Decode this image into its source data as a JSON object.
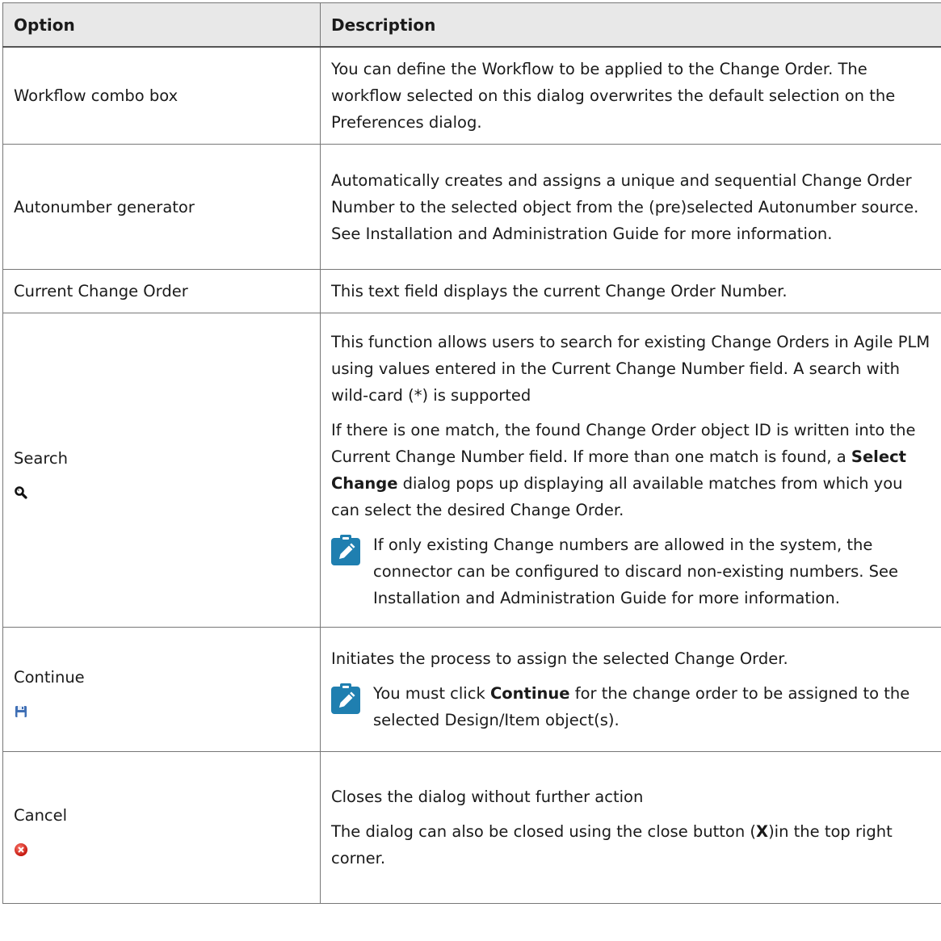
{
  "table": {
    "headers": {
      "option": "Option",
      "description": "Description"
    },
    "rows": [
      {
        "option": "Workflow combo box",
        "description": "You can define the Workflow to be applied to the Change Order. The workflow selected on this dialog overwrites the default selection on the Preferences dialog."
      },
      {
        "option": "Autonumber generator",
        "description": "Automatically creates and assigns a unique and sequential Change Order Number to the selected object from the (pre)selected Autonumber source. See Installation and Administration Guide for more information."
      },
      {
        "option": "Current Change Order",
        "description": "This text field displays the current Change Order Number."
      },
      {
        "option": "Search",
        "icon": "magnifier-icon",
        "description_p1": "This function allows users to search for existing Change Orders in Agile PLM using values entered in the Current Change Number field. A search with wild-card (*) is supported",
        "description_p2_a": "If there is one match, the found Change Order object ID is written into the Current Change Number field. If more than one match is found, a ",
        "description_p2_bold": "Select Change",
        "description_p2_b": " dialog pops up displaying all available matches from which you can select the desired Change Order.",
        "note": "If only existing Change numbers are allowed in the system, the connector can be configured to discard non-existing numbers. See Installation and Administration Guide for more information."
      },
      {
        "option": "Continue",
        "icon": "floppy-disk-icon",
        "description_p1": "Initiates the process to assign the selected Change Order.",
        "note_a": "You must click ",
        "note_bold": "Continue",
        "note_b": " for the change order to be assigned to the selected Design/Item object(s)."
      },
      {
        "option": "Cancel",
        "icon": "red-x-circle-icon",
        "description_p1": "Closes the dialog without further action",
        "description_p2_a": "The dialog can also be closed using the close button (",
        "description_p2_bold": "X",
        "description_p2_b": ")in the top right corner."
      }
    ]
  },
  "colors": {
    "note_icon_bg": "#1f7fb0",
    "header_bg": "#e8e8e8",
    "border": "#777777"
  }
}
